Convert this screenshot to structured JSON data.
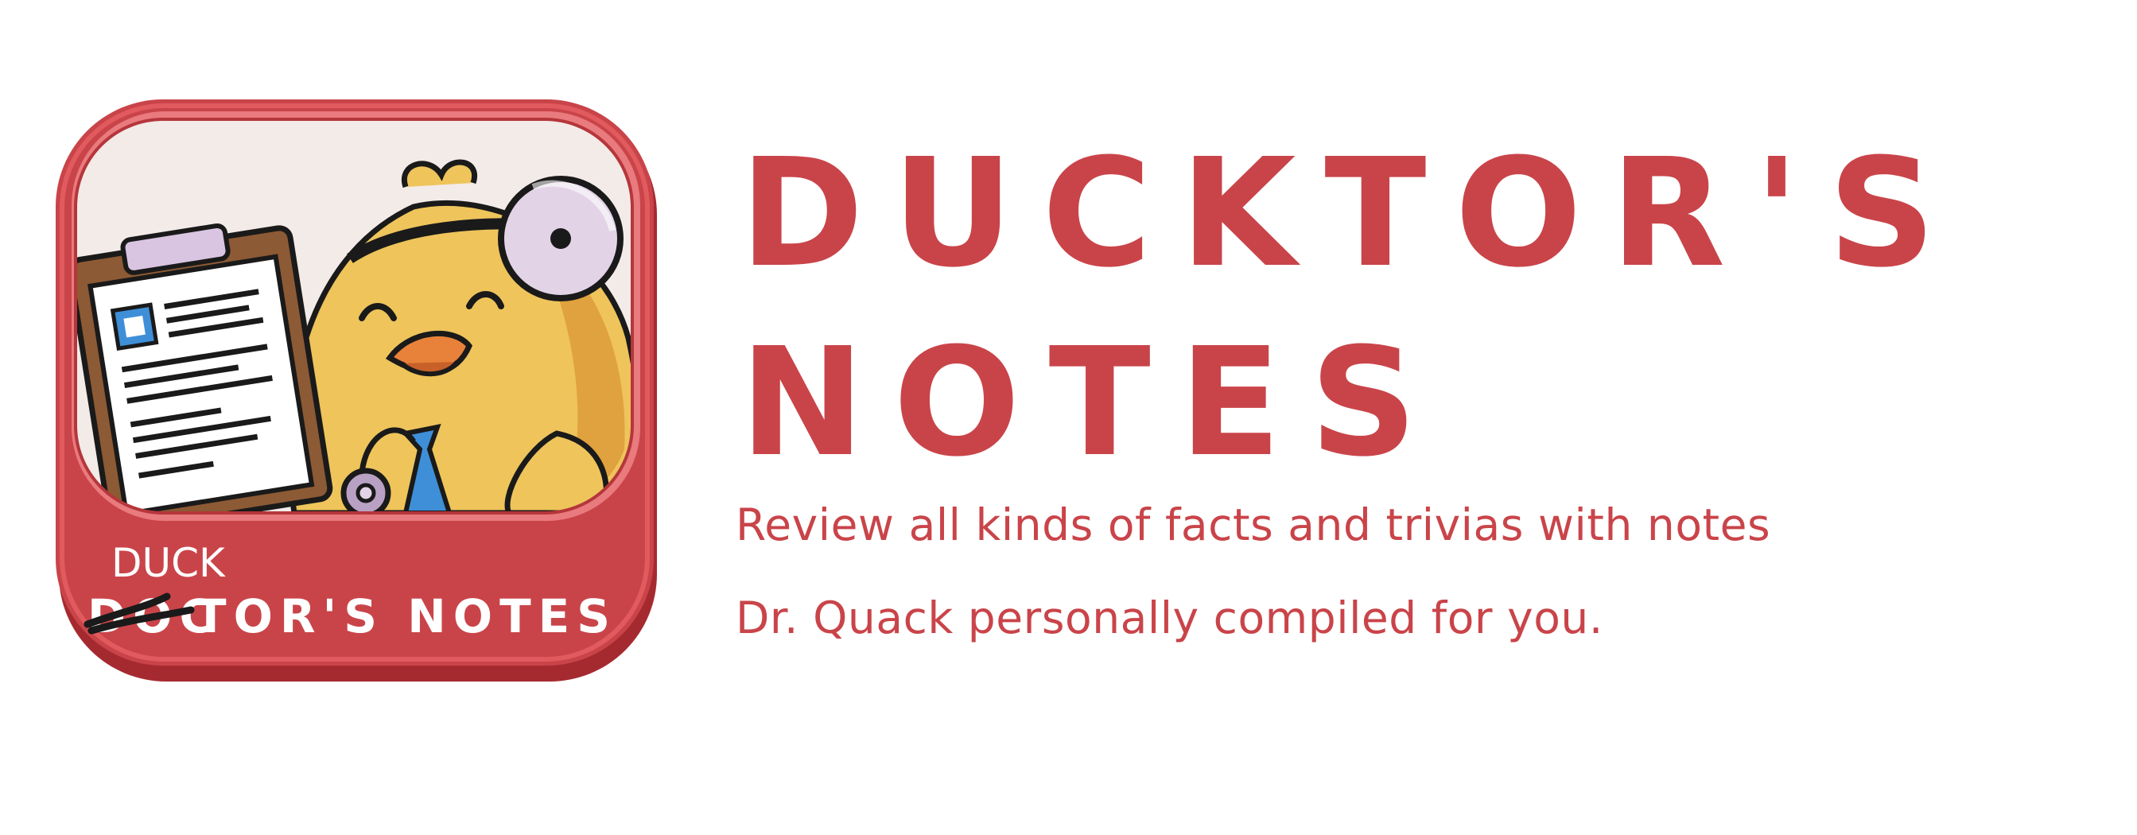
{
  "title": {
    "line1": "DUCKTOR'S",
    "line2": "NOTES"
  },
  "tagline": {
    "line1": "Review all kinds of facts and trivias with notes",
    "line2": "Dr. Quack personally compiled for you."
  },
  "app_icon": {
    "icon": "ducktor-mascot-icon",
    "banner_struck": "DOC",
    "banner_correction": "DUCK",
    "banner_text": "TOR'S NOTES"
  },
  "colors": {
    "title": "#c94449",
    "tagline": "#c94449",
    "icon_frame": "#c94449",
    "icon_frame_dark": "#a52a30",
    "icon_panel": "#f3ebe8",
    "duck_body": "#eec45b",
    "clipboard": "#8c5a34",
    "mirror": "#e2d4e6"
  }
}
